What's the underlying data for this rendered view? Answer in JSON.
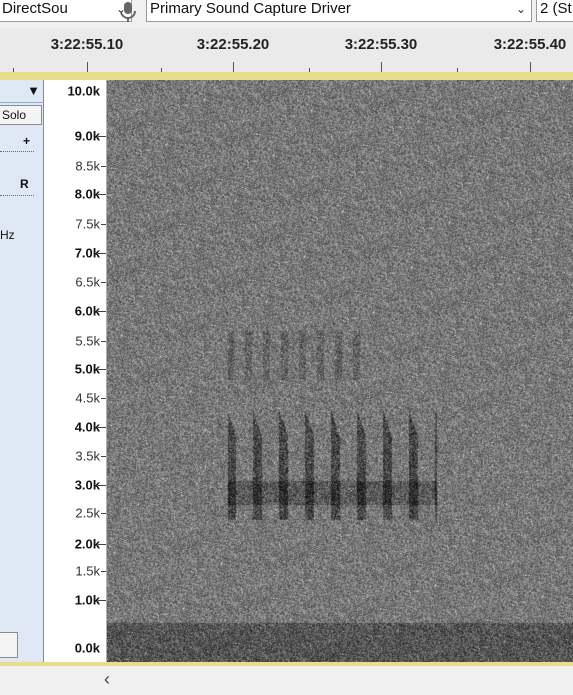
{
  "toolbar": {
    "host": "DirectSou",
    "recording_device": "Primary Sound Capture Driver",
    "channels": "2 (St",
    "mic_icon": "microphone-icon",
    "dropdown_icon": "chevron-down-icon"
  },
  "timeline": {
    "labels": [
      "3:22:55.10",
      "3:22:55.20",
      "3:22:55.30",
      "3:22:55.40"
    ]
  },
  "track": {
    "menu_icon": "triangle-down-icon",
    "solo_label": "Solo",
    "gain_plus": "+",
    "pan_right": "R",
    "rate_text": "Hz"
  },
  "freq_ruler": {
    "labels": [
      "10.0k",
      "9.0k",
      "8.5k",
      "8.0k",
      "7.5k",
      "7.0k",
      "6.5k",
      "6.0k",
      "5.5k",
      "5.0k",
      "4.5k",
      "4.0k",
      "3.5k",
      "3.0k",
      "2.5k",
      "2.0k",
      "1.5k",
      "1.0k",
      "0.0k"
    ]
  },
  "scrollbar": {
    "left_arrow": "‹"
  },
  "colors": {
    "frame": "#e8dd8a",
    "track_panel": "#dfe9f5",
    "spectrogram_base": "#8a8a8a"
  }
}
